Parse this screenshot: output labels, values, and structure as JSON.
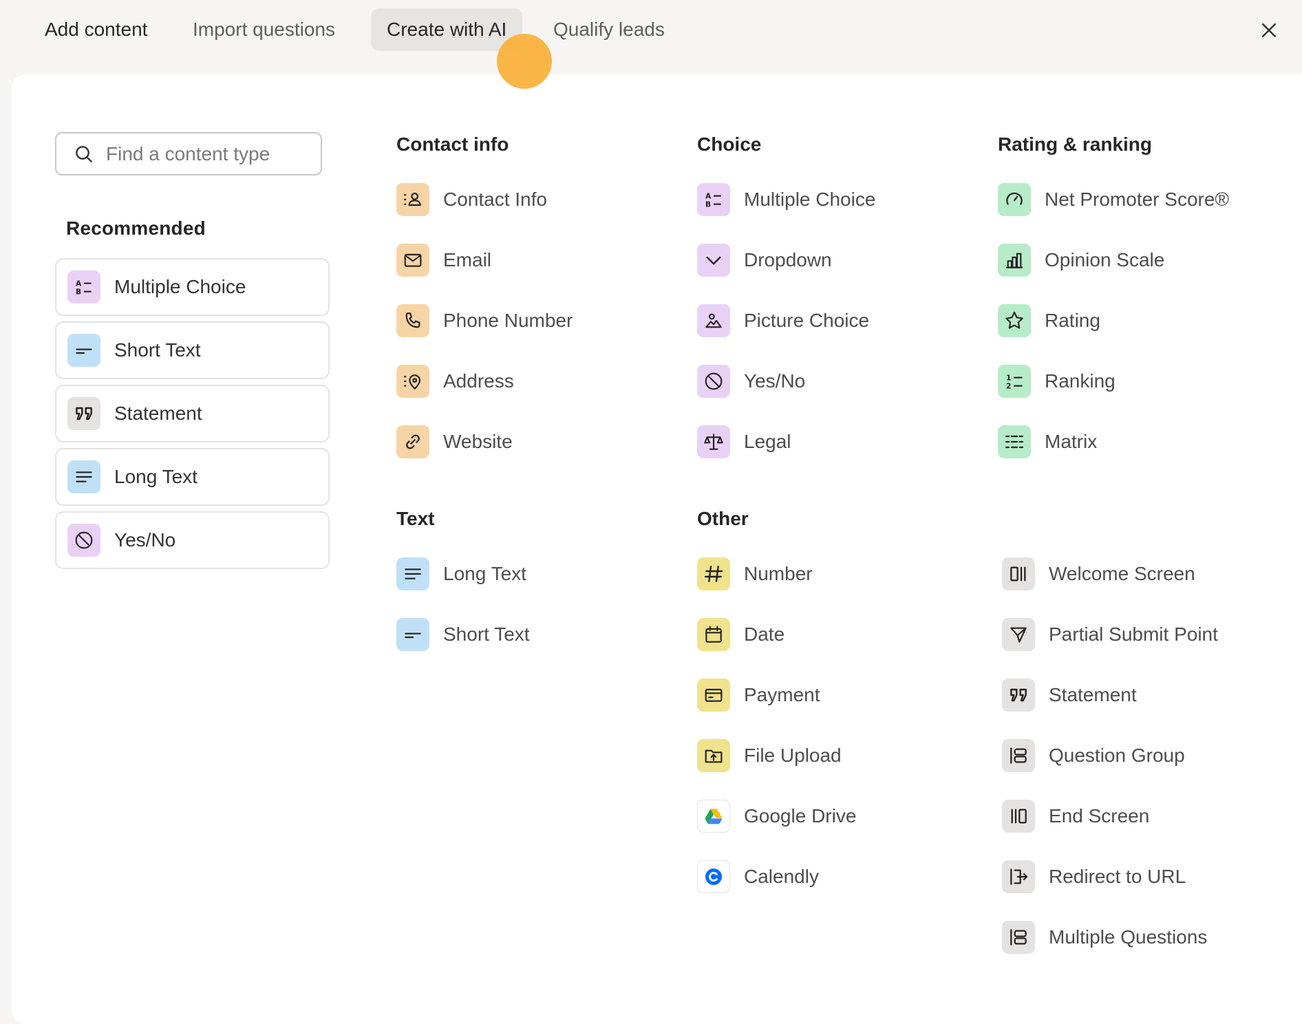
{
  "tabs": [
    "Add content",
    "Import questions",
    "Create with AI",
    "Qualify leads"
  ],
  "search": {
    "placeholder": "Find a content type"
  },
  "recommended": {
    "title": "Recommended",
    "items": [
      {
        "label": "Multiple Choice",
        "icon": "multiple-choice-icon",
        "color": "#e9d1f6"
      },
      {
        "label": "Short Text",
        "icon": "short-text-icon",
        "color": "#bfe0f7"
      },
      {
        "label": "Statement",
        "icon": "quote-icon",
        "color": "#e4e3e1"
      },
      {
        "label": "Long Text",
        "icon": "long-text-icon",
        "color": "#bfe0f7"
      },
      {
        "label": "Yes/No",
        "icon": "yes-no-icon",
        "color": "#e9d1f6"
      }
    ]
  },
  "columns": {
    "contact": {
      "title": "Contact info",
      "items": [
        "Contact Info",
        "Email",
        "Phone Number",
        "Address",
        "Website"
      ]
    },
    "choice": {
      "title": "Choice",
      "items": [
        "Multiple Choice",
        "Dropdown",
        "Picture Choice",
        "Yes/No",
        "Legal"
      ]
    },
    "rating": {
      "title": "Rating & ranking",
      "items": [
        "Net Promoter Score®",
        "Opinion Scale",
        "Rating",
        "Ranking",
        "Matrix"
      ]
    },
    "text": {
      "title": "Text",
      "items": [
        "Long Text",
        "Short Text"
      ]
    },
    "other": {
      "title": "Other",
      "items": [
        "Number",
        "Date",
        "Payment",
        "File Upload",
        "Google Drive",
        "Calendly"
      ]
    },
    "structure": {
      "items": [
        "Welcome Screen",
        "Partial Submit Point",
        "Statement",
        "Question Group",
        "End Screen",
        "Redirect to URL",
        "Multiple Questions"
      ]
    }
  },
  "colors": {
    "contact": "#f7d4a6",
    "choice": "#e9d1f6",
    "rating": "#b7ecc8",
    "text": "#bfe0f7",
    "other": "#f1e28d",
    "structure": "#e4e3e1",
    "cursor": "#fbb13c"
  }
}
